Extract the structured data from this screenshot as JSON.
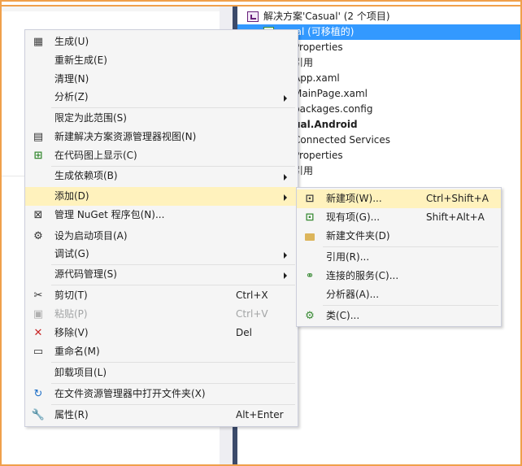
{
  "solution_explorer": {
    "rows": [
      {
        "text": "解决方案'Casual' (2 个项目)",
        "bold": false,
        "selected": false
      },
      {
        "text": "ual (可移植的)",
        "bold": false,
        "selected": true
      },
      {
        "text": "Properties",
        "bold": false,
        "selected": false
      },
      {
        "text": "引用",
        "bold": false,
        "selected": false
      },
      {
        "text": "App.xaml",
        "bold": false,
        "selected": false
      },
      {
        "text": "MainPage.xaml",
        "bold": false,
        "selected": false
      },
      {
        "text": "packages.config",
        "bold": false,
        "selected": false
      },
      {
        "text": "ual.Android",
        "bold": true,
        "selected": false
      },
      {
        "text": "Connected Services",
        "bold": false,
        "selected": false
      },
      {
        "text": "Properties",
        "bold": false,
        "selected": false
      },
      {
        "text": "引用",
        "bold": false,
        "selected": false
      }
    ]
  },
  "context_menu": {
    "items": [
      {
        "label": "生成(U)",
        "shortcut": "",
        "icon": "build-icon",
        "submenu": false
      },
      {
        "label": "重新生成(E)",
        "shortcut": "",
        "icon": "",
        "submenu": false
      },
      {
        "label": "清理(N)",
        "shortcut": "",
        "icon": "",
        "submenu": false
      },
      {
        "label": "分析(Z)",
        "shortcut": "",
        "icon": "",
        "submenu": true
      },
      {
        "label": "限定为此范围(S)",
        "shortcut": "",
        "icon": "",
        "submenu": false
      },
      {
        "label": "新建解决方案资源管理器视图(N)",
        "shortcut": "",
        "icon": "new-view-icon",
        "submenu": false
      },
      {
        "label": "在代码图上显示(C)",
        "shortcut": "",
        "icon": "code-map-icon",
        "submenu": false
      },
      {
        "label": "生成依赖项(B)",
        "shortcut": "",
        "icon": "",
        "submenu": true
      },
      {
        "label": "添加(D)",
        "shortcut": "",
        "icon": "",
        "submenu": true
      },
      {
        "label": "管理 NuGet 程序包(N)...",
        "shortcut": "",
        "icon": "nuget-icon",
        "submenu": false
      },
      {
        "label": "设为启动项目(A)",
        "shortcut": "",
        "icon": "gear-icon",
        "submenu": false
      },
      {
        "label": "调试(G)",
        "shortcut": "",
        "icon": "",
        "submenu": true
      },
      {
        "label": "源代码管理(S)",
        "shortcut": "",
        "icon": "",
        "submenu": true
      },
      {
        "label": "剪切(T)",
        "shortcut": "Ctrl+X",
        "icon": "scissors-icon",
        "submenu": false
      },
      {
        "label": "粘贴(P)",
        "shortcut": "Ctrl+V",
        "icon": "paste-icon",
        "submenu": false
      },
      {
        "label": "移除(V)",
        "shortcut": "Del",
        "icon": "remove-icon",
        "submenu": false
      },
      {
        "label": "重命名(M)",
        "shortcut": "",
        "icon": "rename-icon",
        "submenu": false
      },
      {
        "label": "卸载项目(L)",
        "shortcut": "",
        "icon": "",
        "submenu": false
      },
      {
        "label": "在文件资源管理器中打开文件夹(X)",
        "shortcut": "",
        "icon": "refresh-icon",
        "submenu": false
      },
      {
        "label": "属性(R)",
        "shortcut": "Alt+Enter",
        "icon": "wrench-icon",
        "submenu": false
      }
    ]
  },
  "add_submenu": {
    "items": [
      {
        "label": "新建项(W)...",
        "shortcut": "Ctrl+Shift+A",
        "icon": "new-item-icon"
      },
      {
        "label": "现有项(G)...",
        "shortcut": "Shift+Alt+A",
        "icon": "existing-item-icon"
      },
      {
        "label": "新建文件夹(D)",
        "shortcut": "",
        "icon": "folder-icon"
      },
      {
        "label": "引用(R)...",
        "shortcut": "",
        "icon": ""
      },
      {
        "label": "连接的服务(C)...",
        "shortcut": "",
        "icon": "connected-service-icon"
      },
      {
        "label": "分析器(A)...",
        "shortcut": "",
        "icon": ""
      },
      {
        "label": "类(C)...",
        "shortcut": "",
        "icon": "class-icon"
      }
    ]
  },
  "colors": {
    "selection": "#3399ff",
    "menu_highlight": "#fff2bd",
    "frame": "#f0a04b"
  }
}
